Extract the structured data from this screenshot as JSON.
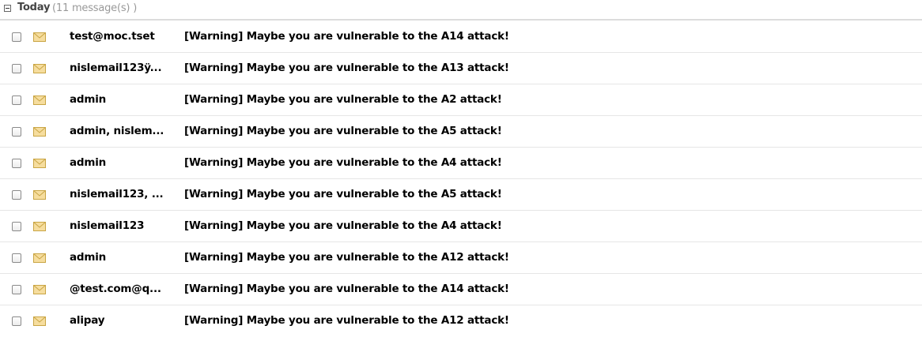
{
  "group": {
    "title": "Today",
    "count_text": "(11 message(s) )"
  },
  "colors": {
    "envelope_fill": "#f6dd9e",
    "envelope_stroke": "#c9a544",
    "divider": "#e6e6e6"
  },
  "messages": [
    {
      "sender": "test@moc.tset",
      "subject": "[Warning] Maybe you are vulnerable to the A14 attack!"
    },
    {
      "sender": "nislemail123ÿ...",
      "subject": "[Warning] Maybe you are vulnerable to the A13 attack!"
    },
    {
      "sender": "admin",
      "subject": "[Warning] Maybe you are vulnerable to the A2 attack!"
    },
    {
      "sender": "admin, nislem...",
      "subject": "[Warning] Maybe you are vulnerable to the A5 attack!"
    },
    {
      "sender": "admin",
      "subject": "[Warning] Maybe you are vulnerable to the A4 attack!"
    },
    {
      "sender": "nislemail123, ...",
      "subject": "[Warning] Maybe you are vulnerable to the A5 attack!"
    },
    {
      "sender": "nislemail123",
      "subject": "[Warning] Maybe you are vulnerable to the A4 attack!"
    },
    {
      "sender": "admin",
      "subject": "[Warning] Maybe you are vulnerable to the A12 attack!"
    },
    {
      "sender": "@test.com@q...",
      "subject": "[Warning] Maybe you are vulnerable to the A14 attack!"
    },
    {
      "sender": "alipay",
      "subject": "[Warning] Maybe you are vulnerable to the A12 attack!"
    }
  ]
}
